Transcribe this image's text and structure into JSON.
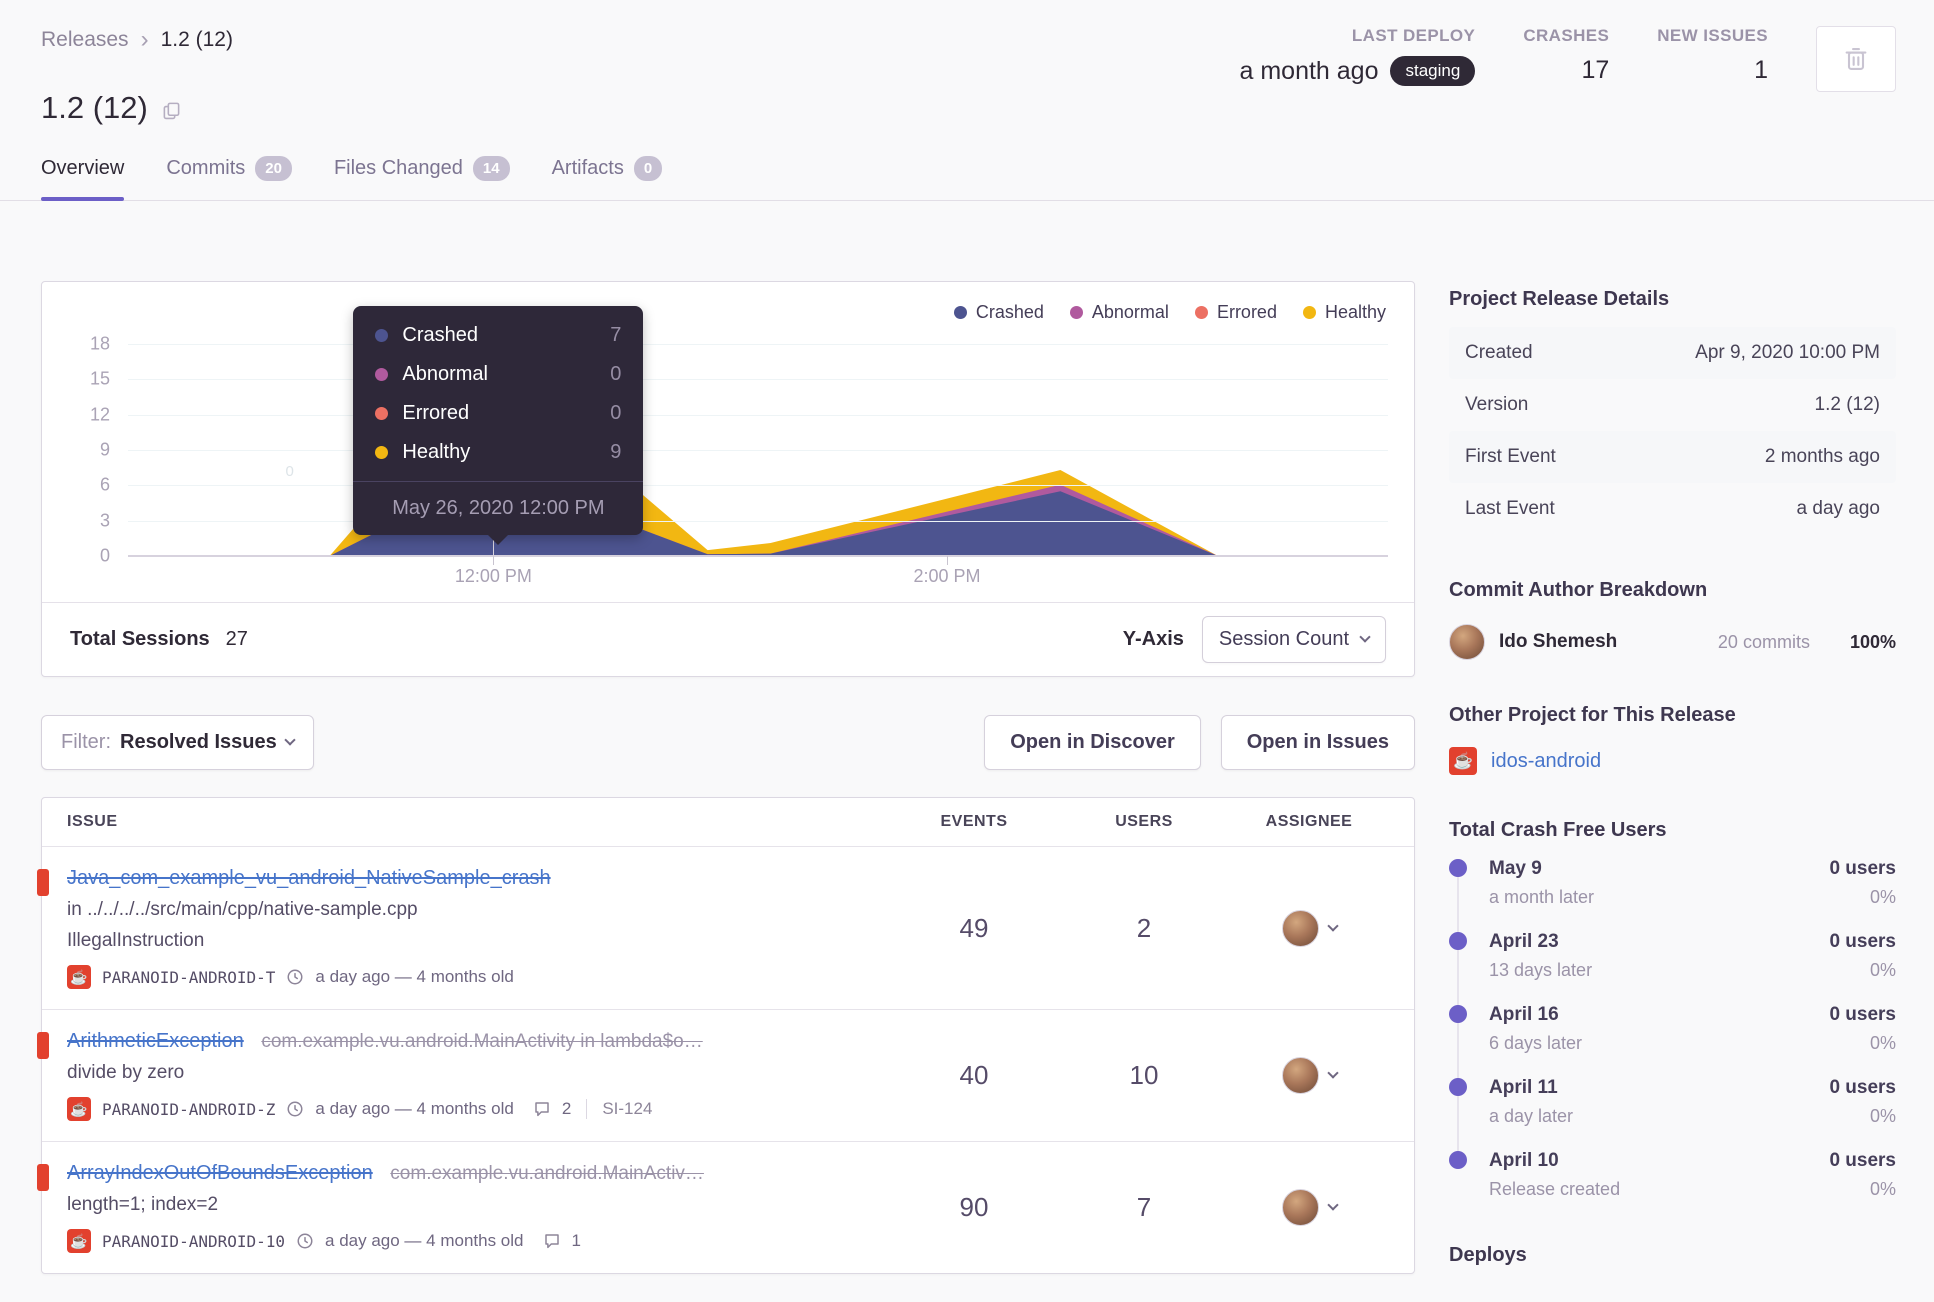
{
  "breadcrumb": {
    "parent": "Releases",
    "sep": "›",
    "current": "1.2 (12)"
  },
  "header": {
    "title": "1.2 (12)",
    "stats": {
      "deploy": {
        "label": "LAST DEPLOY",
        "value": "a month ago",
        "badge": "staging"
      },
      "crashes": {
        "label": "CRASHES",
        "value": "17"
      },
      "new_issues": {
        "label": "NEW ISSUES",
        "value": "1"
      }
    }
  },
  "tabs": [
    {
      "label": "Overview",
      "active": true
    },
    {
      "label": "Commits",
      "count": "20"
    },
    {
      "label": "Files Changed",
      "count": "14"
    },
    {
      "label": "Artifacts",
      "count": "0"
    }
  ],
  "chart_data": {
    "type": "area",
    "stacked": true,
    "y_max": 18,
    "y_ticks": [
      0,
      3,
      6,
      9,
      12,
      15,
      18
    ],
    "x_ticks": [
      {
        "label": "12:00 PM",
        "pos": 0.29
      },
      {
        "label": "2:00 PM",
        "pos": 0.65
      }
    ],
    "x": [
      0,
      0.16,
      0.29,
      0.46,
      0.51,
      0.74,
      0.865,
      1
    ],
    "series": [
      {
        "name": "Crashed",
        "color": "#4d5490",
        "values": [
          0,
          0,
          7,
          0.15,
          0.2,
          5.5,
          0,
          0
        ]
      },
      {
        "name": "Abnormal",
        "color": "#b05a9e",
        "values": [
          0,
          0,
          0,
          0,
          0,
          0.55,
          0,
          0
        ]
      },
      {
        "name": "Errored",
        "color": "#ec7063",
        "values": [
          0,
          0,
          0,
          0,
          0,
          0,
          0,
          0
        ]
      },
      {
        "name": "Healthy",
        "color": "#f2b712",
        "values": [
          0,
          0,
          9,
          0.35,
          0.9,
          1.25,
          0,
          0
        ]
      }
    ],
    "legend_position": "top-right",
    "stray_label": "0",
    "hovered_point": {
      "label": "May 26, 2020 12:00 PM",
      "Crashed": 7,
      "Abnormal": 0,
      "Errored": 0,
      "Healthy": 9
    }
  },
  "tooltip": {
    "rows": [
      {
        "name": "Crashed",
        "value": "7"
      },
      {
        "name": "Abnormal",
        "value": "0"
      },
      {
        "name": "Errored",
        "value": "0"
      },
      {
        "name": "Healthy",
        "value": "9"
      }
    ],
    "footer": "May 26, 2020 12:00 PM"
  },
  "session_footer": {
    "total_label": "Total Sessions",
    "total_value": "27",
    "yaxis_label": "Y-Axis",
    "yaxis_value": "Session Count"
  },
  "filter": {
    "label": "Filter:",
    "value": "Resolved Issues"
  },
  "actions": {
    "discover": "Open in Discover",
    "issues": "Open in Issues"
  },
  "issues": {
    "columns": [
      "ISSUE",
      "EVENTS",
      "USERS",
      "ASSIGNEE"
    ],
    "rows": [
      {
        "title": "Java_com_example_vu_android_NativeSample_crash",
        "suffix": "",
        "lines": [
          "in ../../../../src/main/cpp/native-sample.cpp",
          "IllegalInstruction"
        ],
        "project": "PARANOID-ANDROID-T",
        "age": "a day ago — 4 months old",
        "comments": "",
        "short_id": "",
        "events": "49",
        "users": "2"
      },
      {
        "title": "ArithmeticException",
        "suffix": "com.example.vu.android.MainActivity in lambda$o…",
        "lines": [
          "divide by zero"
        ],
        "project": "PARANOID-ANDROID-Z",
        "age": "a day ago — 4 months old",
        "comments": "2",
        "short_id": "SI-124",
        "events": "40",
        "users": "10"
      },
      {
        "title": "ArrayIndexOutOfBoundsException",
        "suffix": "com.example.vu.android.MainActiv…",
        "lines": [
          "length=1; index=2"
        ],
        "project": "PARANOID-ANDROID-10",
        "age": "a day ago — 4 months old",
        "comments": "1",
        "short_id": "",
        "events": "90",
        "users": "7"
      }
    ]
  },
  "sidebar": {
    "details": {
      "title": "Project Release Details",
      "rows": [
        {
          "label": "Created",
          "value": "Apr 9, 2020 10:00 PM"
        },
        {
          "label": "Version",
          "value": "1.2 (12)"
        },
        {
          "label": "First Event",
          "value": "2 months ago"
        },
        {
          "label": "Last Event",
          "value": "a day ago"
        }
      ]
    },
    "authors": {
      "title": "Commit Author Breakdown",
      "name": "Ido Shemesh",
      "commits": "20 commits",
      "percent": "100%"
    },
    "other_project": {
      "title": "Other Project for This Release",
      "link": "idos-android"
    },
    "crash_free": {
      "title": "Total Crash Free Users",
      "entries": [
        {
          "date": "May 9",
          "sub": "a month later",
          "users": "0 users",
          "pct": "0%"
        },
        {
          "date": "April 23",
          "sub": "13 days later",
          "users": "0 users",
          "pct": "0%"
        },
        {
          "date": "April 16",
          "sub": "6 days later",
          "users": "0 users",
          "pct": "0%"
        },
        {
          "date": "April 11",
          "sub": "a day later",
          "users": "0 users",
          "pct": "0%"
        },
        {
          "date": "April 10",
          "sub": "Release created",
          "users": "0 users",
          "pct": "0%"
        }
      ]
    },
    "deploys": {
      "title": "Deploys"
    }
  },
  "colors": {
    "accent": "#6c5fc7",
    "link": "#4674ca",
    "red": "#e2412e"
  }
}
